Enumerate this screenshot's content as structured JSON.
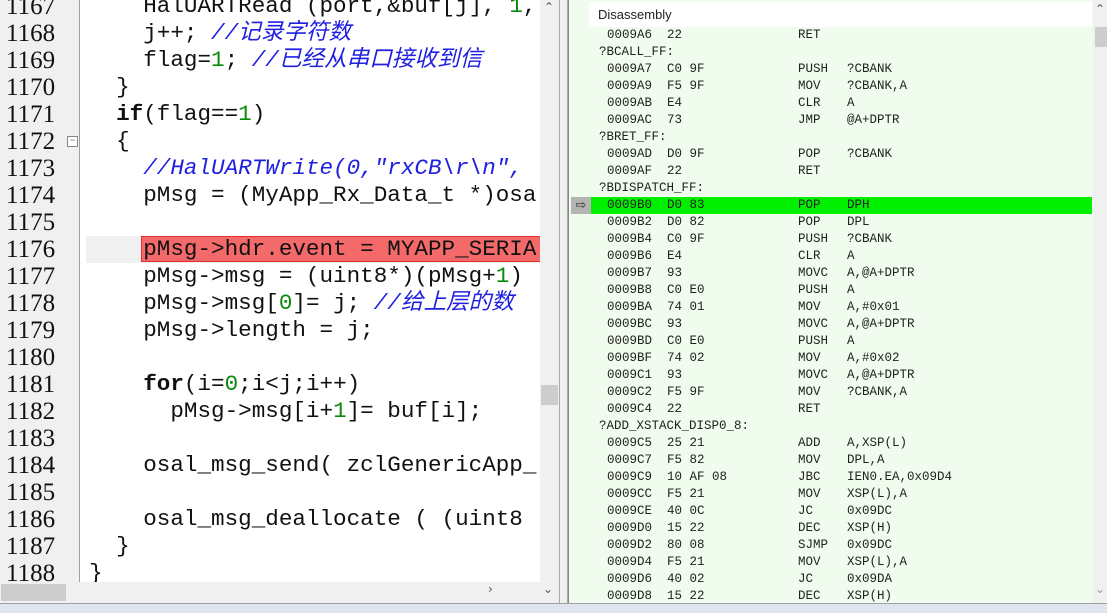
{
  "editor": {
    "current_line": "1176",
    "lines": [
      {
        "num": "1167",
        "seg": [
          {
            "t": "    HalUARTRead (port,&buf[j], "
          },
          {
            "t": "1",
            "c": "num"
          },
          {
            "t": ","
          }
        ]
      },
      {
        "num": "1168",
        "seg": [
          {
            "t": "    j++; "
          },
          {
            "t": "//记录字符数",
            "c": "cmt"
          }
        ]
      },
      {
        "num": "1169",
        "seg": [
          {
            "t": "    flag="
          },
          {
            "t": "1",
            "c": "num"
          },
          {
            "t": "; "
          },
          {
            "t": "//已经从串口接收到信",
            "c": "cmt"
          }
        ]
      },
      {
        "num": "1170",
        "seg": [
          {
            "t": "  }"
          }
        ]
      },
      {
        "num": "1171",
        "seg": [
          {
            "t": "  "
          },
          {
            "t": "if",
            "c": "kw"
          },
          {
            "t": "(flag=="
          },
          {
            "t": "1",
            "c": "num"
          },
          {
            "t": ")"
          }
        ]
      },
      {
        "num": "1172",
        "fold": "−",
        "seg": [
          {
            "t": "  {"
          }
        ]
      },
      {
        "num": "1173",
        "seg": [
          {
            "t": "    "
          },
          {
            "t": "//HalUARTWrite(0,\"rxCB\\r\\n\",",
            "c": "cmt"
          }
        ]
      },
      {
        "num": "1174",
        "seg": [
          {
            "t": "    pMsg = (MyApp_Rx_Data_t *)osa"
          }
        ]
      },
      {
        "num": "1175",
        "seg": []
      },
      {
        "num": "1176",
        "seg": [
          {
            "t": "    pMsg->hdr.event = MYAPP_SERIA"
          }
        ]
      },
      {
        "num": "1177",
        "seg": [
          {
            "t": "    pMsg->msg = (uint8*)(pMsg+"
          },
          {
            "t": "1",
            "c": "num"
          },
          {
            "t": ")"
          }
        ]
      },
      {
        "num": "1178",
        "seg": [
          {
            "t": "    pMsg->msg["
          },
          {
            "t": "0",
            "c": "num"
          },
          {
            "t": "]= j; "
          },
          {
            "t": "//给上层的数",
            "c": "cmt"
          }
        ]
      },
      {
        "num": "1179",
        "seg": [
          {
            "t": "    pMsg->length = j;"
          }
        ]
      },
      {
        "num": "1180",
        "seg": []
      },
      {
        "num": "1181",
        "seg": [
          {
            "t": "    "
          },
          {
            "t": "for",
            "c": "kw"
          },
          {
            "t": "(i="
          },
          {
            "t": "0",
            "c": "num"
          },
          {
            "t": ";i<j;i++)"
          }
        ]
      },
      {
        "num": "1182",
        "seg": [
          {
            "t": "      pMsg->msg[i+"
          },
          {
            "t": "1",
            "c": "num"
          },
          {
            "t": "]= buf[i];"
          }
        ]
      },
      {
        "num": "1183",
        "seg": []
      },
      {
        "num": "1184",
        "seg": [
          {
            "t": "    osal_msg_send( zclGenericApp_"
          }
        ]
      },
      {
        "num": "1185",
        "seg": []
      },
      {
        "num": "1186",
        "seg": [
          {
            "t": "    osal_msg_deallocate ( (uint8"
          }
        ]
      },
      {
        "num": "1187",
        "seg": [
          {
            "t": "  }"
          }
        ]
      },
      {
        "num": "1188",
        "seg": [
          {
            "t": "}"
          }
        ]
      }
    ]
  },
  "disassembly": {
    "title": "Disassembly",
    "current_address": "0009B0",
    "rows": [
      {
        "addr": "0009A6",
        "bytes": "22",
        "op": "RET",
        "arg": ""
      },
      {
        "label": "?BCALL_FF:"
      },
      {
        "addr": "0009A7",
        "bytes": "C0 9F",
        "op": "PUSH",
        "arg": "?CBANK"
      },
      {
        "addr": "0009A9",
        "bytes": "F5 9F",
        "op": "MOV",
        "arg": "?CBANK,A"
      },
      {
        "addr": "0009AB",
        "bytes": "E4",
        "op": "CLR",
        "arg": "A"
      },
      {
        "addr": "0009AC",
        "bytes": "73",
        "op": "JMP",
        "arg": "@A+DPTR"
      },
      {
        "label": "?BRET_FF:"
      },
      {
        "addr": "0009AD",
        "bytes": "D0 9F",
        "op": "POP",
        "arg": "?CBANK"
      },
      {
        "addr": "0009AF",
        "bytes": "22",
        "op": "RET",
        "arg": ""
      },
      {
        "label": "?BDISPATCH_FF:"
      },
      {
        "addr": "0009B0",
        "bytes": "D0 83",
        "op": "POP",
        "arg": "DPH",
        "current": true
      },
      {
        "addr": "0009B2",
        "bytes": "D0 82",
        "op": "POP",
        "arg": "DPL"
      },
      {
        "addr": "0009B4",
        "bytes": "C0 9F",
        "op": "PUSH",
        "arg": "?CBANK"
      },
      {
        "addr": "0009B6",
        "bytes": "E4",
        "op": "CLR",
        "arg": "A"
      },
      {
        "addr": "0009B7",
        "bytes": "93",
        "op": "MOVC",
        "arg": "A,@A+DPTR"
      },
      {
        "addr": "0009B8",
        "bytes": "C0 E0",
        "op": "PUSH",
        "arg": "A"
      },
      {
        "addr": "0009BA",
        "bytes": "74 01",
        "op": "MOV",
        "arg": "A,#0x01"
      },
      {
        "addr": "0009BC",
        "bytes": "93",
        "op": "MOVC",
        "arg": "A,@A+DPTR"
      },
      {
        "addr": "0009BD",
        "bytes": "C0 E0",
        "op": "PUSH",
        "arg": "A"
      },
      {
        "addr": "0009BF",
        "bytes": "74 02",
        "op": "MOV",
        "arg": "A,#0x02"
      },
      {
        "addr": "0009C1",
        "bytes": "93",
        "op": "MOVC",
        "arg": "A,@A+DPTR"
      },
      {
        "addr": "0009C2",
        "bytes": "F5 9F",
        "op": "MOV",
        "arg": "?CBANK,A"
      },
      {
        "addr": "0009C4",
        "bytes": "22",
        "op": "RET",
        "arg": ""
      },
      {
        "label": "?ADD_XSTACK_DISP0_8:"
      },
      {
        "addr": "0009C5",
        "bytes": "25 21",
        "op": "ADD",
        "arg": "A,XSP(L)"
      },
      {
        "addr": "0009C7",
        "bytes": "F5 82",
        "op": "MOV",
        "arg": "DPL,A"
      },
      {
        "addr": "0009C9",
        "bytes": "10 AF 08",
        "op": "JBC",
        "arg": "IEN0.EA,0x09D4"
      },
      {
        "addr": "0009CC",
        "bytes": "F5 21",
        "op": "MOV",
        "arg": "XSP(L),A"
      },
      {
        "addr": "0009CE",
        "bytes": "40 0C",
        "op": "JC",
        "arg": "0x09DC"
      },
      {
        "addr": "0009D0",
        "bytes": "15 22",
        "op": "DEC",
        "arg": "XSP(H)"
      },
      {
        "addr": "0009D2",
        "bytes": "80 08",
        "op": "SJMP",
        "arg": "0x09DC"
      },
      {
        "addr": "0009D4",
        "bytes": "F5 21",
        "op": "MOV",
        "arg": "XSP(L),A"
      },
      {
        "addr": "0009D6",
        "bytes": "40 02",
        "op": "JC",
        "arg": "0x09DA"
      },
      {
        "addr": "0009D8",
        "bytes": "15 22",
        "op": "DEC",
        "arg": "XSP(H)"
      }
    ]
  },
  "colors": {
    "current_line_bg": "#f46a6a",
    "disasm_current": "#00f000",
    "disasm_bg": "#f0fced"
  }
}
